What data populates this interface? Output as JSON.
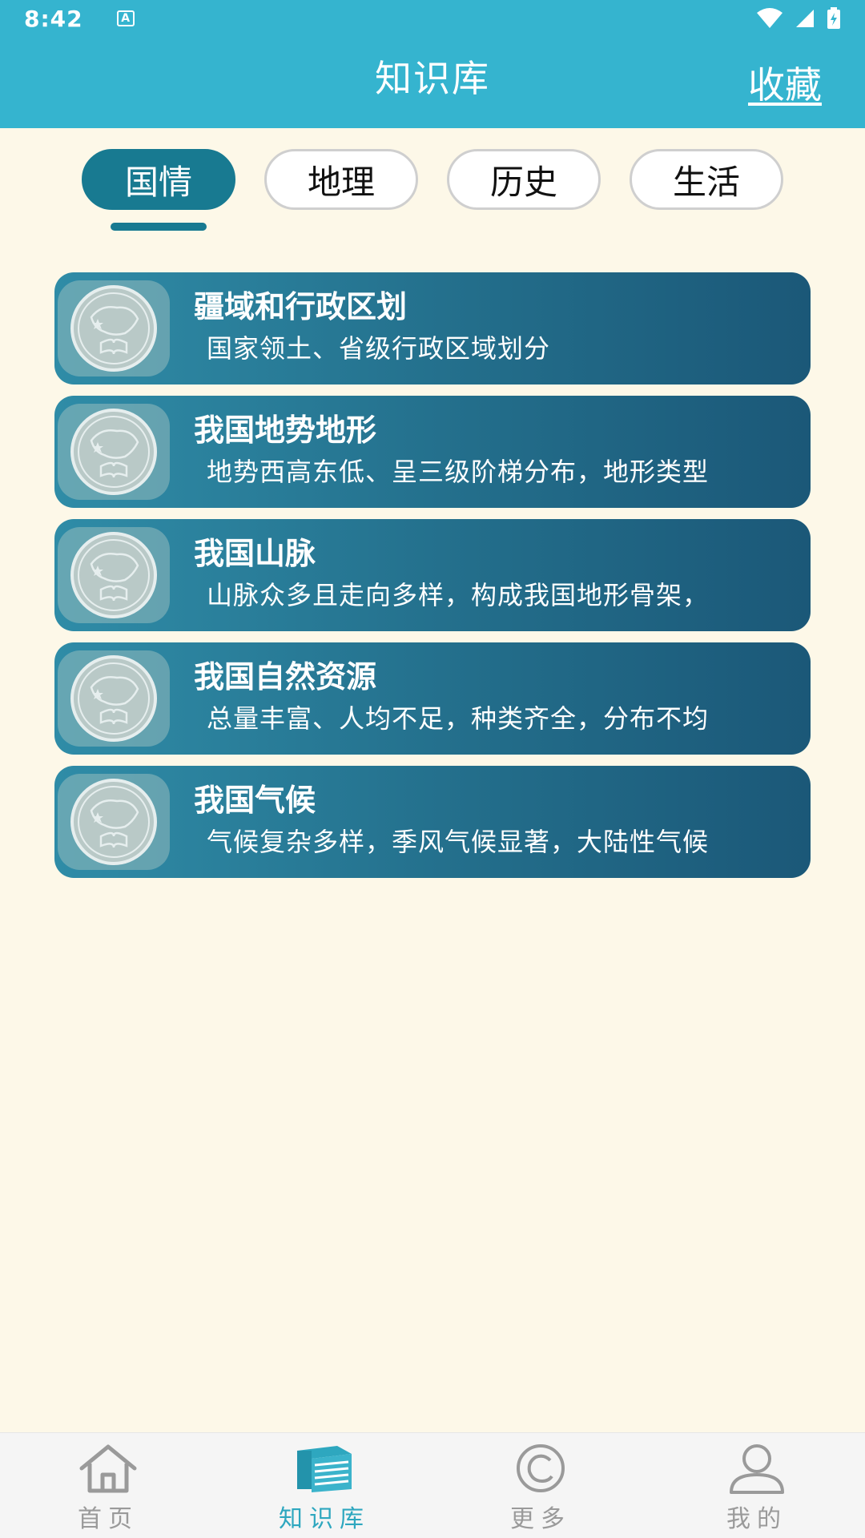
{
  "status": {
    "time": "8:42",
    "notif": "A"
  },
  "toolbar": {
    "title": "知识库",
    "favorite_label": "收藏"
  },
  "tabs": [
    {
      "label": "国情",
      "active": true
    },
    {
      "label": "地理",
      "active": false
    },
    {
      "label": "历史",
      "active": false
    },
    {
      "label": "生活",
      "active": false
    }
  ],
  "cards": [
    {
      "title": "疆域和行政区划",
      "desc": "国家领土、省级行政区域划分"
    },
    {
      "title": "我国地势地形",
      "desc": "地势西高东低、呈三级阶梯分布，地形类型"
    },
    {
      "title": "我国山脉",
      "desc": "山脉众多且走向多样，构成我国地形骨架，"
    },
    {
      "title": "我国自然资源",
      "desc": "总量丰富、人均不足，种类齐全，分布不均"
    },
    {
      "title": "我国气候",
      "desc": "气候复杂多样，季风气候显著，大陆性气候"
    }
  ],
  "bottom_nav": [
    {
      "label": "首页",
      "icon": "home-icon",
      "active": false
    },
    {
      "label": "知识库",
      "icon": "books-icon",
      "active": true
    },
    {
      "label": "更多",
      "icon": "copyright-icon",
      "active": false
    },
    {
      "label": "我的",
      "icon": "user-icon",
      "active": false
    }
  ],
  "colors": {
    "header": "#35b4cf",
    "accent": "#187a91",
    "background": "#fdf8e8",
    "nav_active": "#2ea7bf"
  }
}
